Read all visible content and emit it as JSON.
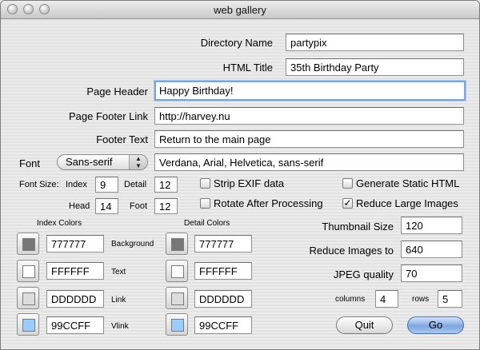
{
  "window": {
    "title": "web gallery"
  },
  "form": {
    "directory_name": {
      "label": "Directory Name",
      "value": "partypix"
    },
    "html_title": {
      "label": "HTML Title",
      "value": "35th Birthday Party"
    },
    "page_header": {
      "label": "Page Header",
      "value": "Happy Birthday!"
    },
    "page_footer_link": {
      "label": "Page Footer Link",
      "value": "http://harvey.nu"
    },
    "footer_text": {
      "label": "Footer Text",
      "value": "Return to the main page"
    },
    "font": {
      "label": "Font",
      "selected": "Sans-serif",
      "value": "Verdana, Arial, Helvetica, sans-serif"
    },
    "font_size": {
      "label": "Font Size:",
      "index_label": "Index",
      "index": "9",
      "detail_label": "Detail",
      "detail": "12",
      "head_label": "Head",
      "head": "14",
      "foot_label": "Foot",
      "foot": "12"
    }
  },
  "options": {
    "strip_exif": {
      "label": "Strip EXIF data",
      "checked": false
    },
    "generate_static": {
      "label": "Generate Static HTML",
      "checked": false
    },
    "rotate": {
      "label": "Rotate After Processing",
      "checked": false
    },
    "reduce_large": {
      "label": "Reduce Large Images",
      "checked": true,
      "mark": "✓"
    }
  },
  "index_colors": {
    "header": "Index Colors",
    "rows": [
      {
        "label": "Background",
        "value": "777777",
        "color": "#777777"
      },
      {
        "label": "Text",
        "value": "FFFFFF",
        "color": "#FFFFFF"
      },
      {
        "label": "Link",
        "value": "DDDDDD",
        "color": "#DDDDDD"
      },
      {
        "label": "Vlink",
        "value": "99CCFF",
        "color": "#99CCFF"
      }
    ]
  },
  "detail_colors": {
    "header": "Detail Colors",
    "rows": [
      {
        "value": "777777",
        "color": "#777777"
      },
      {
        "value": "FFFFFF",
        "color": "#FFFFFF"
      },
      {
        "value": "DDDDDD",
        "color": "#DDDDDD"
      },
      {
        "value": "99CCFF",
        "color": "#99CCFF"
      }
    ]
  },
  "image_settings": {
    "thumbnail_size": {
      "label": "Thumbnail Size",
      "value": "120"
    },
    "reduce_to": {
      "label": "Reduce Images to",
      "value": "640"
    },
    "jpeg_quality": {
      "label": "JPEG quality",
      "value": "70"
    },
    "columns": {
      "label": "columns",
      "value": "4"
    },
    "rows": {
      "label": "rows",
      "value": "5"
    }
  },
  "buttons": {
    "quit": "Quit",
    "go": "Go"
  }
}
